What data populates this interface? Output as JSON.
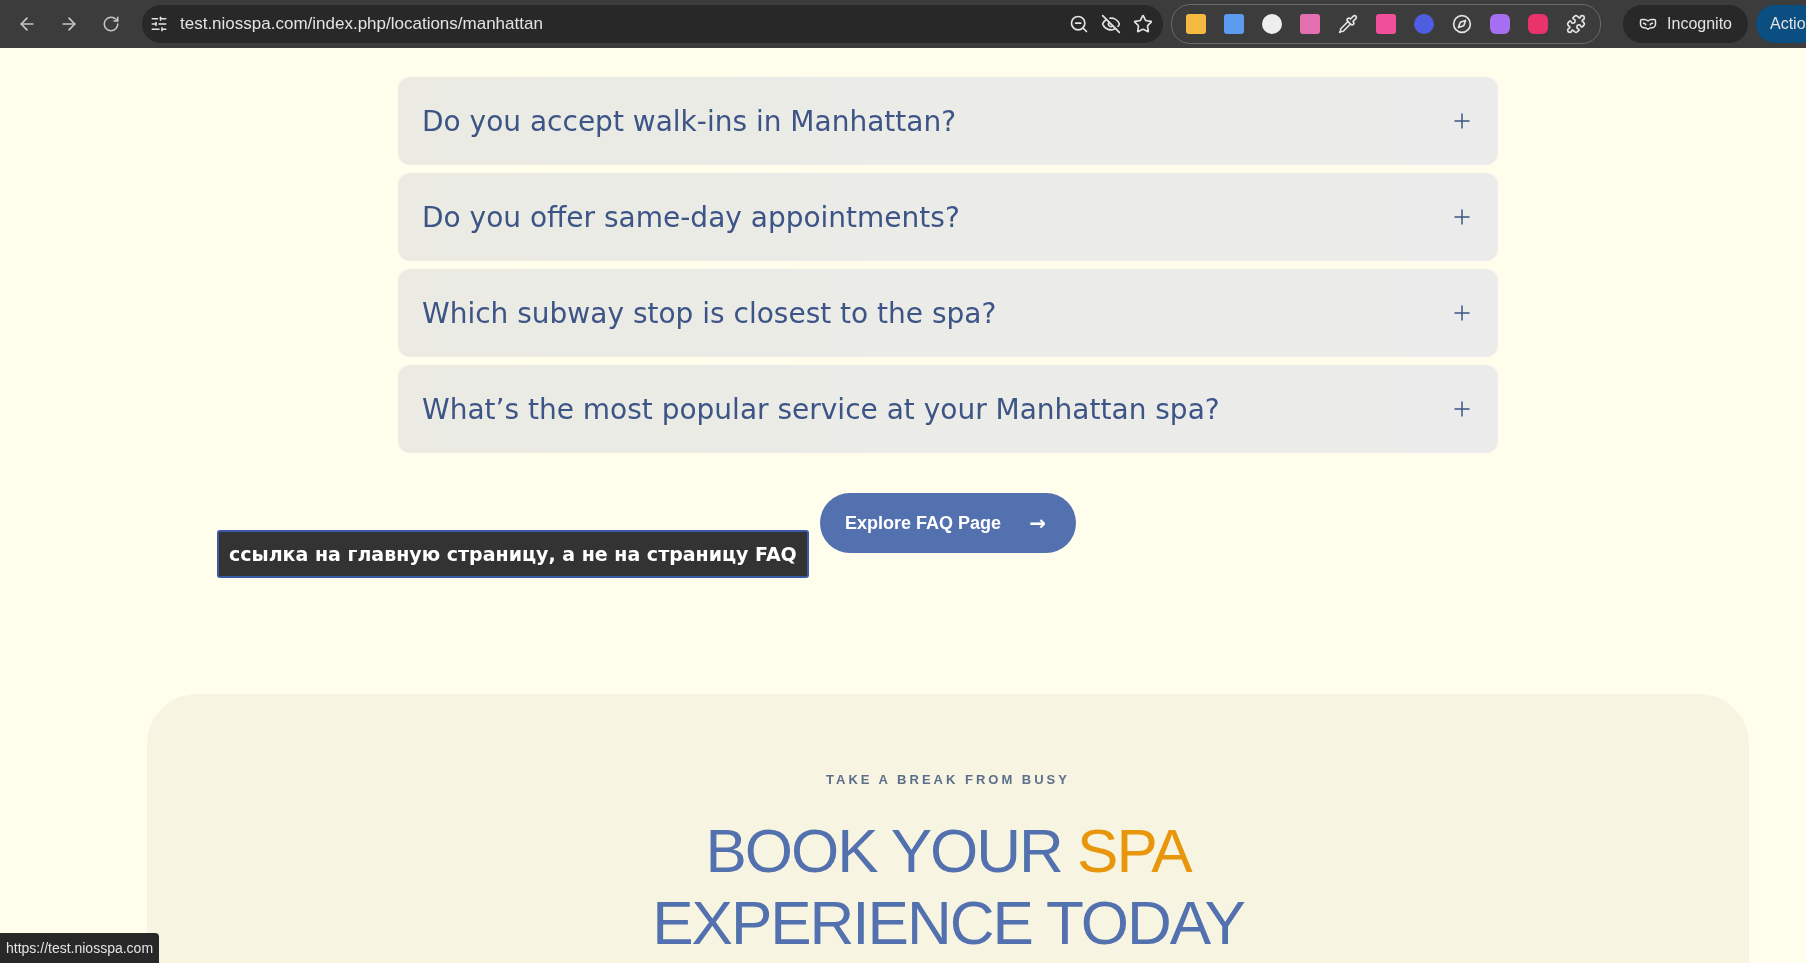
{
  "browser": {
    "url": "test.niosspa.com/index.php/locations/manhattan",
    "incognito_label": "Incognito",
    "action_button": "Actio"
  },
  "faq": [
    {
      "question": "Do you accept walk-ins in Manhattan?",
      "expanded": false
    },
    {
      "question": "Do you offer same-day appointments?",
      "expanded": false
    },
    {
      "question": "Which subway stop is closest to the spa?",
      "expanded": false
    },
    {
      "question": "What’s the most popular service at your Manhattan spa?",
      "expanded": false
    }
  ],
  "faq_button": {
    "label": "Explore FAQ Page",
    "arrow": "→"
  },
  "annotation": "ссылка на главную страницу, а не на страницу FAQ",
  "booking": {
    "eyebrow": "TAKE A BREAK FROM BUSY",
    "heading_start": "BOOK YOUR",
    "heading_accent": "SPA",
    "heading_end": "EXPERIENCE TODAY"
  },
  "status_url": "https://test.niosspa.com"
}
